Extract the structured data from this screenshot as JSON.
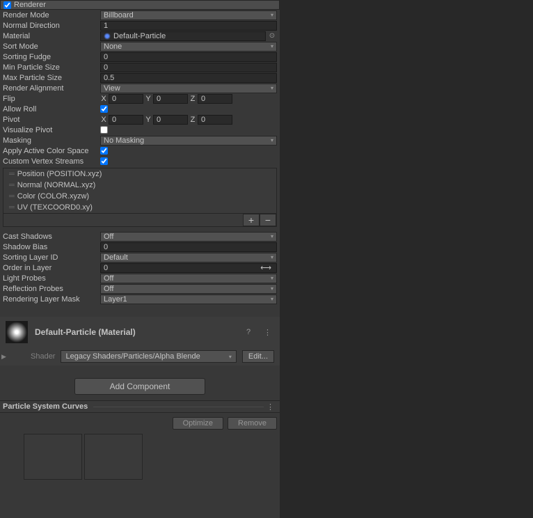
{
  "renderer": {
    "title": "Renderer",
    "enabled": true,
    "renderMode": {
      "label": "Render Mode",
      "value": "Billboard"
    },
    "normalDirection": {
      "label": "Normal Direction",
      "value": "1"
    },
    "material": {
      "label": "Material",
      "value": "Default-Particle"
    },
    "sortMode": {
      "label": "Sort Mode",
      "value": "None"
    },
    "sortingFudge": {
      "label": "Sorting Fudge",
      "value": "0"
    },
    "minParticleSize": {
      "label": "Min Particle Size",
      "value": "0"
    },
    "maxParticleSize": {
      "label": "Max Particle Size",
      "value": "0.5"
    },
    "renderAlignment": {
      "label": "Render Alignment",
      "value": "View"
    },
    "flip": {
      "label": "Flip",
      "x": "0",
      "y": "0",
      "z": "0"
    },
    "allowRoll": {
      "label": "Allow Roll",
      "checked": true
    },
    "pivot": {
      "label": "Pivot",
      "x": "0",
      "y": "0",
      "z": "0"
    },
    "visualizePivot": {
      "label": "Visualize Pivot",
      "checked": false
    },
    "masking": {
      "label": "Masking",
      "value": "No Masking"
    },
    "applyActiveColorSpace": {
      "label": "Apply Active Color Space",
      "checked": true
    },
    "customVertexStreams": {
      "label": "Custom Vertex Streams",
      "checked": true
    },
    "vertexStreams": [
      "Position (POSITION.xyz)",
      "Normal (NORMAL.xyz)",
      "Color (COLOR.xyzw)",
      "UV (TEXCOORD0.xy)"
    ],
    "castShadows": {
      "label": "Cast Shadows",
      "value": "Off"
    },
    "shadowBias": {
      "label": "Shadow Bias",
      "value": "0"
    },
    "sortingLayerID": {
      "label": "Sorting Layer ID",
      "value": "Default"
    },
    "orderInLayer": {
      "label": "Order in Layer",
      "value": "0"
    },
    "lightProbes": {
      "label": "Light Probes",
      "value": "Off"
    },
    "reflectionProbes": {
      "label": "Reflection Probes",
      "value": "Off"
    },
    "renderingLayerMask": {
      "label": "Rendering Layer Mask",
      "value": "Layer1"
    }
  },
  "materialSection": {
    "title": "Default-Particle (Material)",
    "shaderLabel": "Shader",
    "shaderValue": "Legacy Shaders/Particles/Alpha Blende",
    "editLabel": "Edit..."
  },
  "addComponent": "Add Component",
  "curves": {
    "title": "Particle System Curves",
    "optimize": "Optimize",
    "remove": "Remove"
  },
  "axes": {
    "x": "X",
    "y": "Y",
    "z": "Z"
  }
}
